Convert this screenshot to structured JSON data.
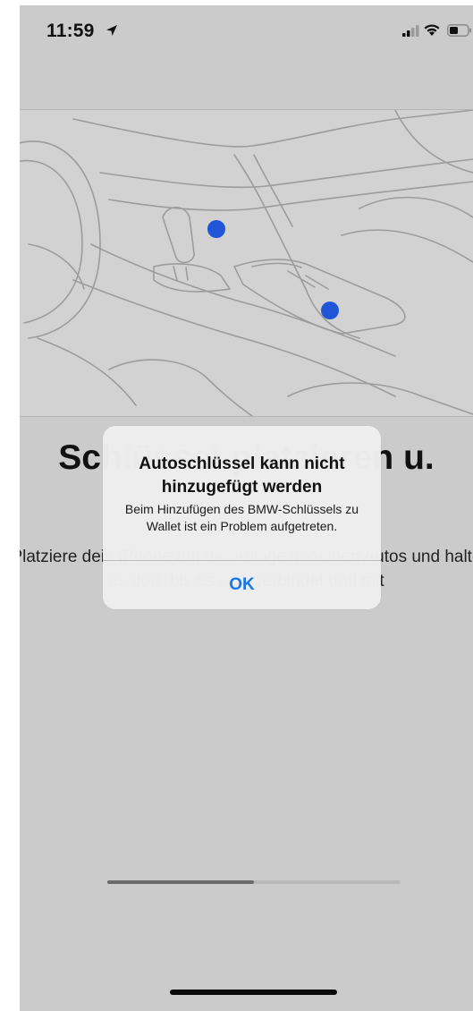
{
  "status_bar": {
    "time": "11:59",
    "icons": [
      "location-arrow-icon",
      "cellular-signal-icon",
      "wifi-icon",
      "battery-icon"
    ]
  },
  "illustration": {
    "description_icon": "car-interior-illustration",
    "hotspot_color": "#1f55d6"
  },
  "page": {
    "title": "Schlüssel platzieren u.",
    "description": "Platziere dein iPhone auf der Ablage in deinen Autos und halte es dort, bis es sich verbindet und mit"
  },
  "alert": {
    "title": "Autoschlüssel kann nicht hinzugefügt werden",
    "message": "Beim Hinzufügen des BMW-Schlüssels zu Wallet ist ein Problem aufgetreten.",
    "ok_label": "OK",
    "accent_color": "#1877e8"
  },
  "progress": {
    "fraction": 0.5
  }
}
